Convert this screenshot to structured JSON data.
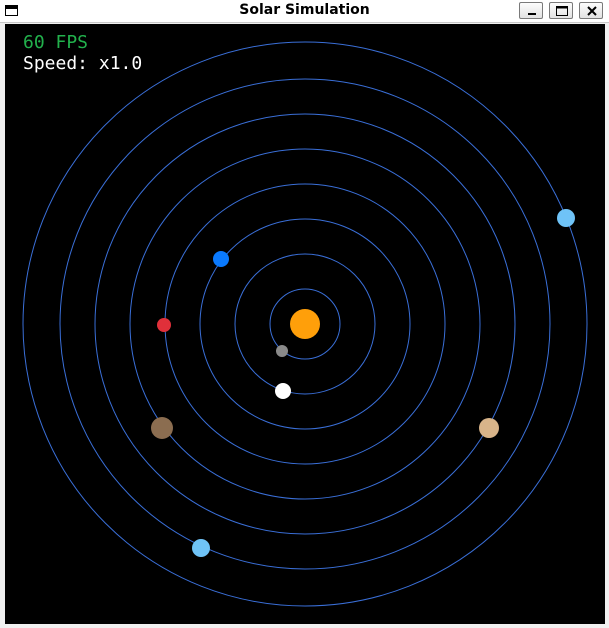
{
  "window": {
    "title": "Solar Simulation",
    "app_icon": "window-icon",
    "controls": {
      "minimize_icon": "minimize-icon",
      "maximize_icon": "maximize-icon",
      "close_icon": "close-icon"
    }
  },
  "hud": {
    "fps_text": "60 FPS",
    "fps_color": "#22b14c",
    "speed_text": "Speed: x1.0",
    "speed_color": "#ffffff"
  },
  "colors": {
    "background": "#000000",
    "orbit": "#3a6fd8",
    "sun": "#ff9f0a"
  },
  "planets": [
    {
      "name": "mercury",
      "color": "#8a8a8a"
    },
    {
      "name": "venus",
      "color": "#ffffff"
    },
    {
      "name": "earth",
      "color": "#0a7aff"
    },
    {
      "name": "mars",
      "color": "#e0303a"
    },
    {
      "name": "jupiter",
      "color": "#8b6d50"
    },
    {
      "name": "saturn",
      "color": "#d8b48a"
    },
    {
      "name": "uranus",
      "color": "#6fc3f7"
    },
    {
      "name": "neptune",
      "color": "#6fc3f7"
    }
  ]
}
